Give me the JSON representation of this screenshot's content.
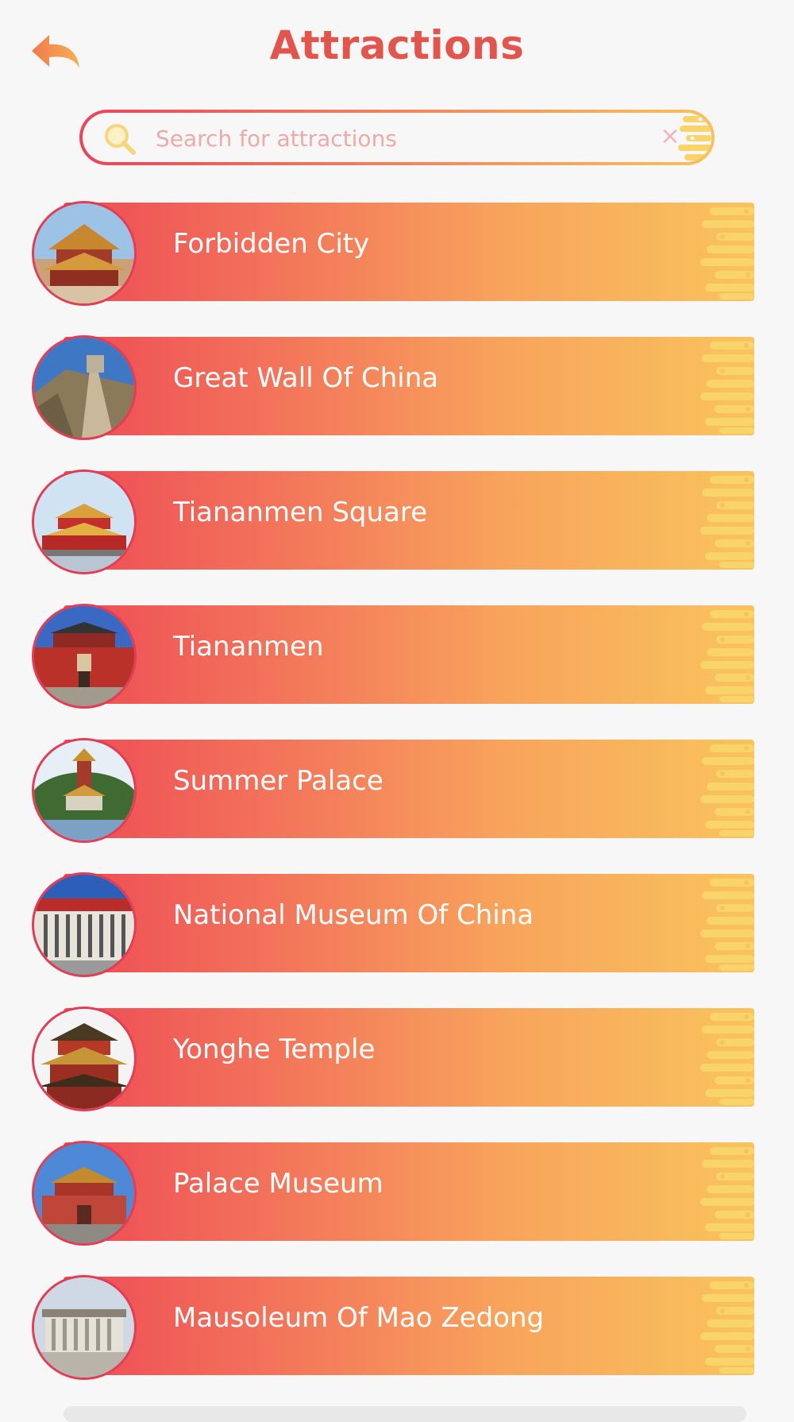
{
  "header": {
    "title": "Attractions",
    "back_icon": "back-arrow-icon"
  },
  "search": {
    "placeholder": "Search for attractions",
    "value": "",
    "search_icon": "search-icon",
    "clear_icon": "clear-icon",
    "clear_glyph": "×"
  },
  "colors": {
    "accent": "#e2554d",
    "gradient_start": "#ee4a55",
    "gradient_end": "#f9c35d",
    "thumb_border": "#e43c52"
  },
  "attractions": [
    {
      "name": "Forbidden City",
      "thumb": "forbidden-city-photo"
    },
    {
      "name": "Great Wall Of China",
      "thumb": "great-wall-photo"
    },
    {
      "name": "Tiananmen Square",
      "thumb": "tiananmen-square-photo"
    },
    {
      "name": "Tiananmen",
      "thumb": "tiananmen-gate-photo"
    },
    {
      "name": "Summer Palace",
      "thumb": "summer-palace-photo"
    },
    {
      "name": "National Museum Of China",
      "thumb": "national-museum-photo"
    },
    {
      "name": "Yonghe Temple",
      "thumb": "yonghe-temple-photo"
    },
    {
      "name": "Palace Museum",
      "thumb": "palace-museum-photo"
    },
    {
      "name": "Mausoleum Of Mao Zedong",
      "thumb": "mao-mausoleum-photo"
    }
  ]
}
